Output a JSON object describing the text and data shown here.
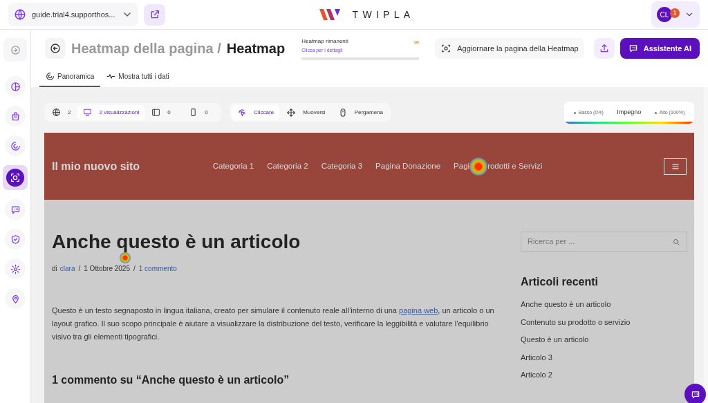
{
  "topbar": {
    "site": "guide.trial4.supporthos...",
    "logo": "TWIPLA",
    "avatar": {
      "initials": "CL",
      "badge": "1"
    }
  },
  "sidebar": {
    "items": [
      {
        "selected": false
      },
      {
        "selected": false
      },
      {
        "selected": false
      },
      {
        "selected": false
      },
      {
        "selected": true
      },
      {
        "selected": false
      },
      {
        "selected": false
      },
      {
        "selected": false
      },
      {
        "selected": false
      }
    ]
  },
  "header": {
    "parent": "Heatmap della pagina /",
    "current": "Heatmap",
    "quota": {
      "title": "Heatmap rimanenti",
      "link": "Clicca per i dettagli",
      "value": "∞"
    },
    "refresh_button": "Aggiornare la pagina della Heatmap",
    "assistant_button": "Assistente AI"
  },
  "tabs": [
    {
      "label": "Panoramica",
      "selected": true
    },
    {
      "label": "Mostra tutti i dati",
      "selected": false
    }
  ],
  "devices": [
    {
      "label": "2",
      "selected": false
    },
    {
      "label": "2 visualizzazioni",
      "selected": true
    },
    {
      "label": "0",
      "selected": false
    },
    {
      "label": "0",
      "selected": false
    }
  ],
  "modes": [
    {
      "label": "Cliccare",
      "selected": true
    },
    {
      "label": "Muoversi",
      "selected": false
    },
    {
      "label": "Pergamena",
      "selected": false
    }
  ],
  "legend": {
    "low": "Basso (0%)",
    "title": "Impegno",
    "high": "Alto (100%)"
  },
  "preview": {
    "site_title": "Il mio nuovo sito",
    "nav": [
      {
        "label": "Categoria 1"
      },
      {
        "label": "Categoria 2"
      },
      {
        "label": "Categoria 3"
      },
      {
        "label": "Pagina Donazione"
      },
      {
        "label": "Pagi",
        "label_after_spot": "rodotti e Servizi"
      }
    ],
    "title": "Anche questo è un articolo",
    "meta": {
      "by": "di",
      "author": "clara",
      "separator_1": "/",
      "date": "1 Ottobre 2025",
      "separator_2": "/",
      "comments": "1 commento"
    },
    "paragraph": {
      "before": "Questo è un testo segnaposto in lingua italiana, creato per simulare il contenuto reale all’interno di una",
      "link": "pagina web",
      "after": ", un articolo o un layout grafico. Il suo scopo principale è aiutare a visualizzare la distribuzione del testo, verificare la leggibilità e valutare l’equilibrio visivo tra gli elementi tipografici."
    },
    "comments_title": "1 commento su “Anche questo è un articolo”",
    "search_placeholder": "Ricerca per ...",
    "recent_title": "Articoli recenti",
    "recent": [
      "Anche questo è un articolo",
      "Contenuto su prodotto o servizio",
      "Questo è un articolo",
      "Articolo 3",
      "Articolo 2"
    ]
  }
}
